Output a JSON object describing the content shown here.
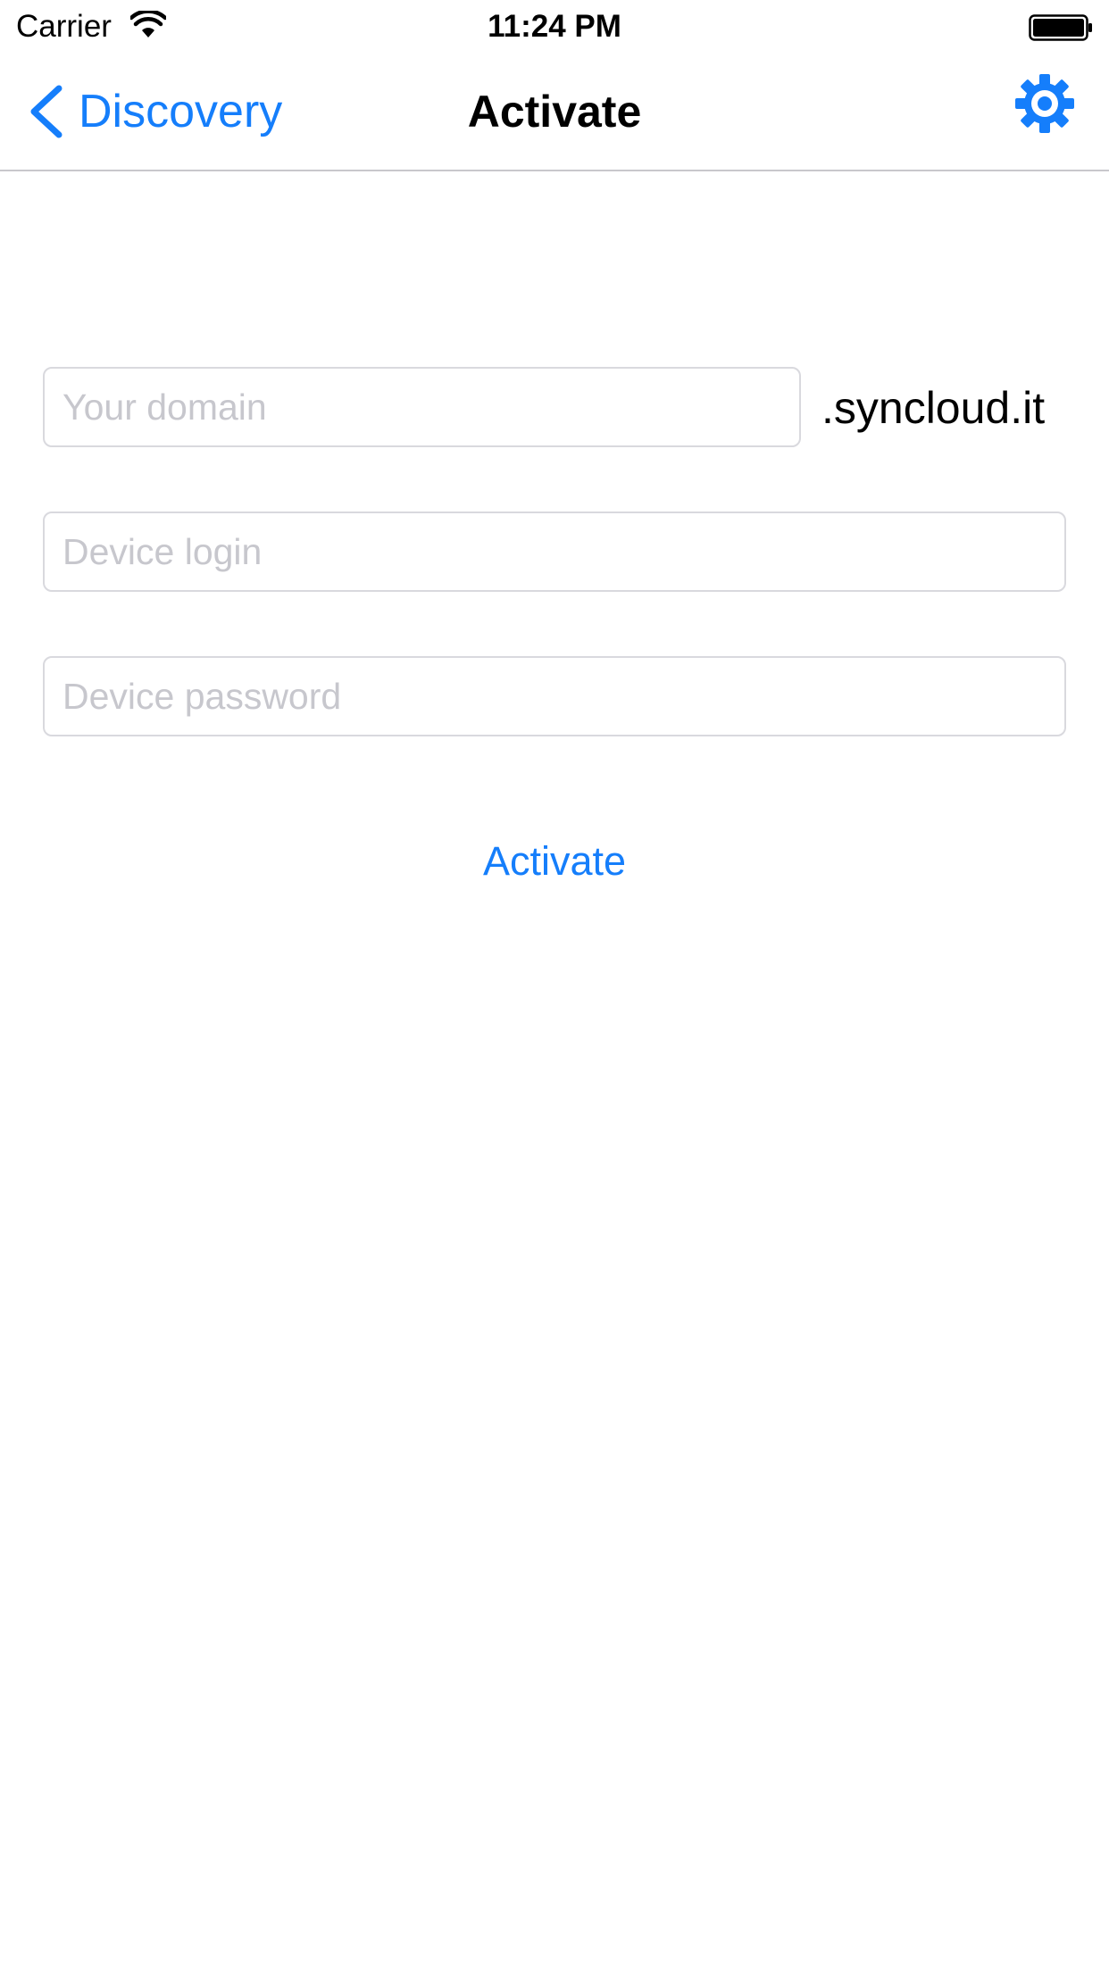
{
  "status_bar": {
    "carrier": "Carrier",
    "time": "11:24 PM"
  },
  "nav": {
    "back_label": "Discovery",
    "title": "Activate",
    "settings_icon": "gear-icon"
  },
  "form": {
    "domain": {
      "placeholder": "Your domain",
      "value": ""
    },
    "domain_suffix": ".syncloud.it",
    "login": {
      "placeholder": "Device login",
      "value": ""
    },
    "password": {
      "placeholder": "Device password",
      "value": ""
    },
    "activate_label": "Activate"
  },
  "colors": {
    "accent": "#157efb",
    "placeholder": "#c7c7cd",
    "field_border": "#d9d9de",
    "separator": "#c8c7cc"
  }
}
